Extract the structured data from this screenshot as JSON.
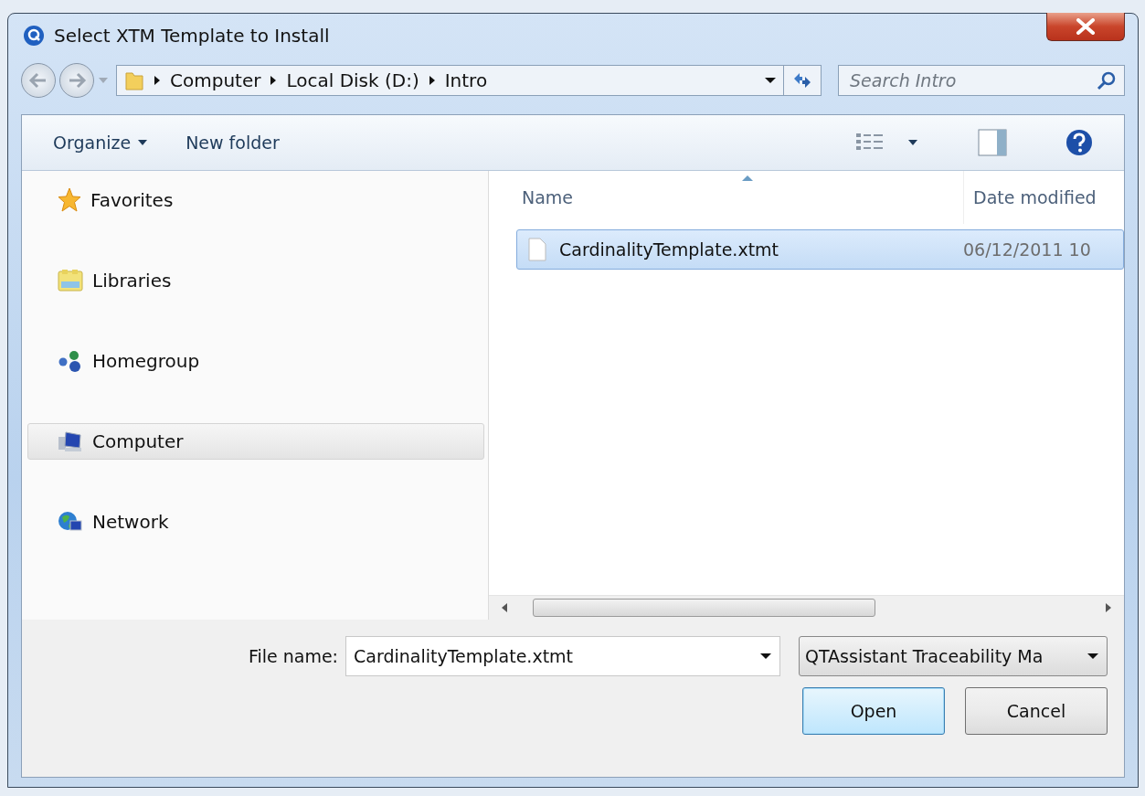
{
  "window": {
    "title": "Select XTM Template to Install"
  },
  "address_bar": {
    "path": [
      "Computer",
      "Local Disk (D:)",
      "Intro"
    ]
  },
  "search": {
    "placeholder": "Search Intro"
  },
  "toolbar": [
    {
      "label": "Organize",
      "kind": "menu"
    },
    {
      "label": "New folder",
      "kind": "button"
    }
  ],
  "sidebar": {
    "items": [
      {
        "label": "Favorites",
        "selected": false
      },
      {
        "label": "Libraries",
        "selected": false
      },
      {
        "label": "Homegroup",
        "selected": false
      },
      {
        "label": "Computer",
        "selected": true
      },
      {
        "label": "Network",
        "selected": false
      }
    ]
  },
  "file_list": {
    "columns": [
      "Name",
      "Date modified"
    ],
    "rows": [
      {
        "name": "CardinalityTemplate.xtmt",
        "date": "06/12/2011 10",
        "selected": true
      }
    ]
  },
  "file_name": {
    "label": "File name:",
    "value": "CardinalityTemplate.xtmt"
  },
  "file_type": {
    "value": "QTAssistant Traceability Ma"
  },
  "buttons": [
    {
      "label": "Open",
      "default": true
    },
    {
      "label": "Cancel",
      "default": false
    }
  ]
}
